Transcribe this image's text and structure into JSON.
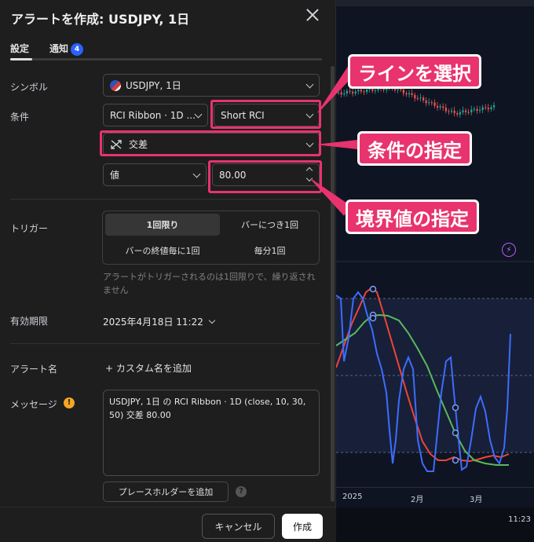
{
  "dialog": {
    "title": "アラートを作成: USDJPY, 1日",
    "tabs": [
      {
        "label": "設定",
        "active": true
      },
      {
        "label": "通知",
        "badge": "4"
      }
    ],
    "labels": {
      "symbol": "シンボル",
      "condition": "条件",
      "trigger": "トリガー",
      "expiry": "有効期限",
      "alert_name": "アラート名",
      "message": "メッセージ"
    },
    "symbol_value": "USDJPY, 1日",
    "condition_indicator": "RCI Ribbon · 1D ...",
    "condition_line": "Short RCI",
    "condition_operator": "交差",
    "value_type": "値",
    "value": "80.00",
    "trigger_options": [
      "1回限り",
      "バーにつき1回",
      "バーの終値毎に1回",
      "毎分1回"
    ],
    "trigger_selected": "1回限り",
    "trigger_note": "アラートがトリガーされるのは1回限りで、繰り返されません",
    "expiry_value": "2025年4月18日 11:22",
    "add_name": "+  カスタム名を追加",
    "message_text": "USDJPY, 1日 の RCI Ribbon · 1D (close, 10, 30, 50) 交差 80.00",
    "placeholder_button": "プレースホルダーを追加",
    "buttons": {
      "cancel": "キャンセル",
      "create": "作成"
    }
  },
  "chart": {
    "x_labels": [
      "2025",
      "2月",
      "3月"
    ],
    "time_label": "11:23",
    "series_colors": {
      "short": "#3d6cff",
      "middle": "#5cb85c",
      "long": "#f04438"
    }
  },
  "annotations": {
    "select_line": "ラインを選択",
    "specify_condition": "条件の指定",
    "specify_threshold": "境界値の指定",
    "color": "#e8336e"
  }
}
